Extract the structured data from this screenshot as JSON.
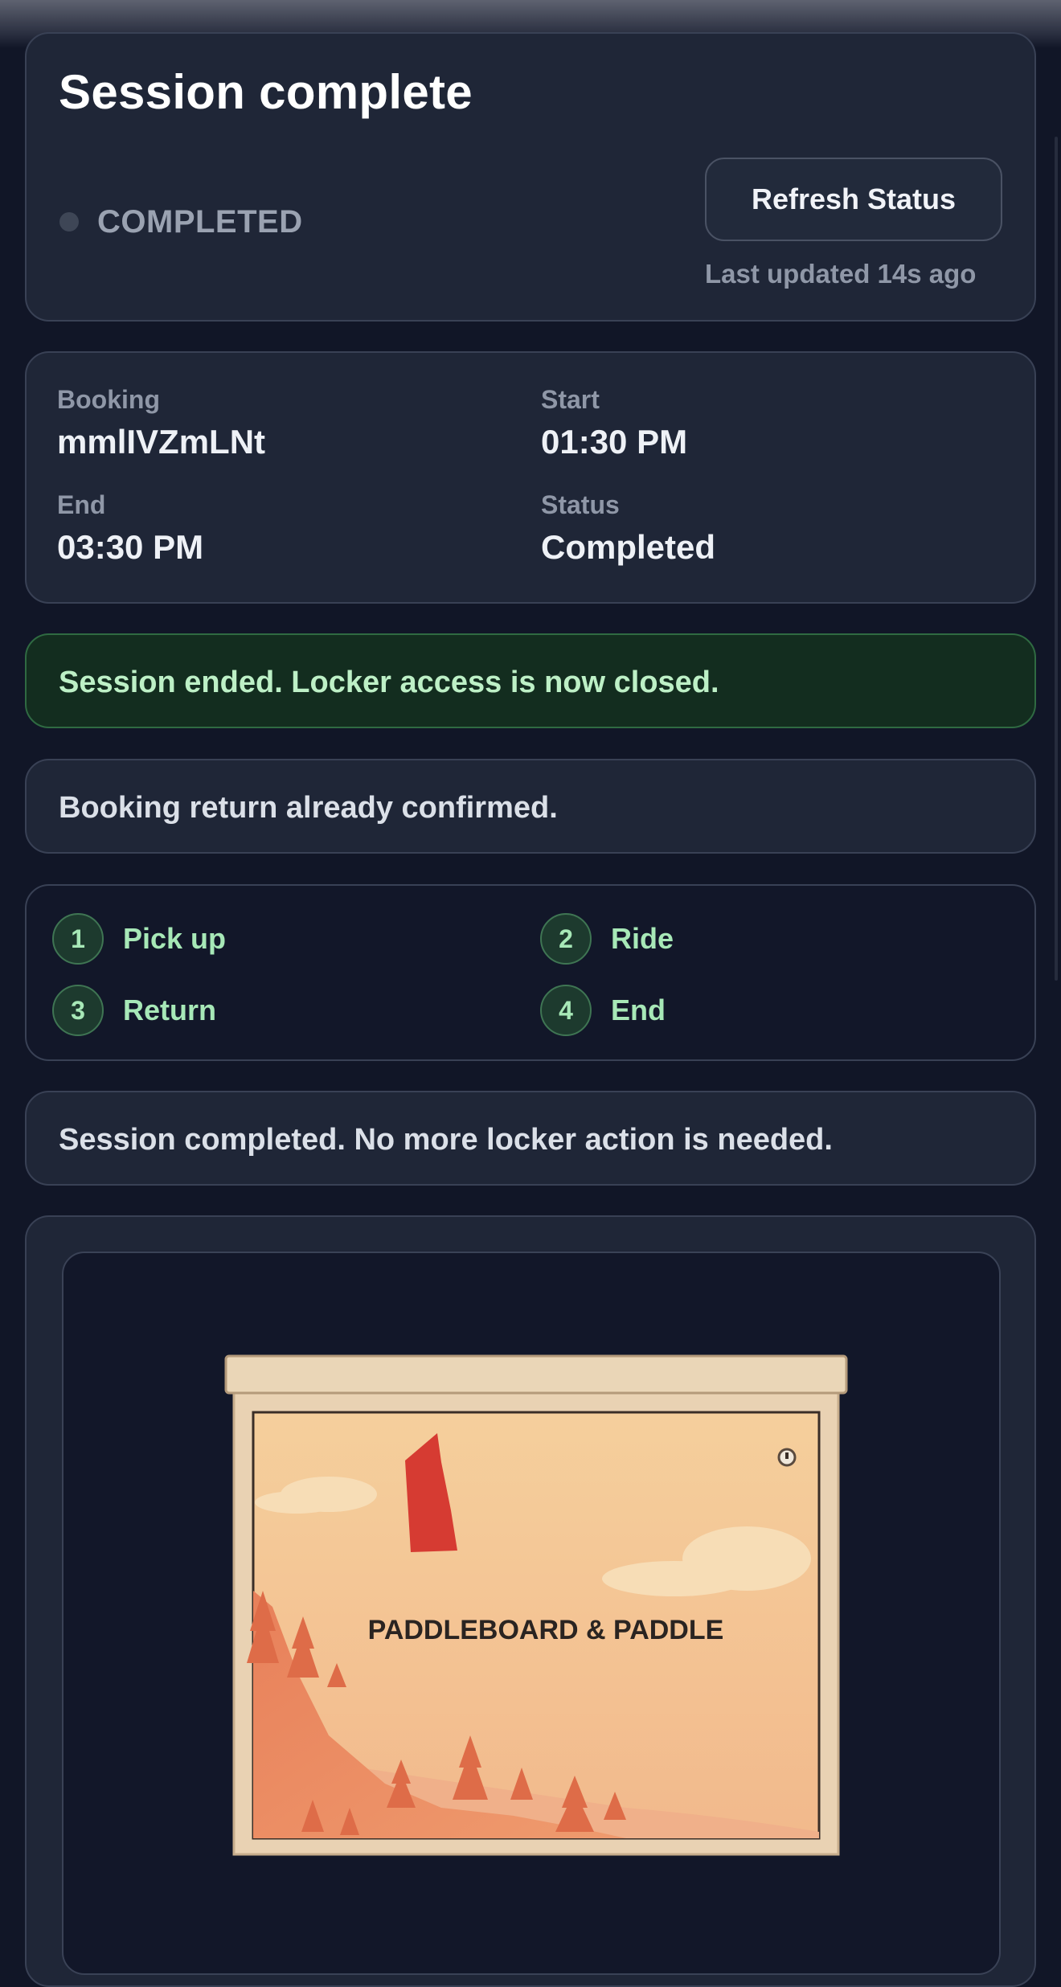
{
  "header": {
    "title": "Session complete",
    "status": "COMPLETED",
    "refresh_label": "Refresh Status",
    "last_updated": "Last updated 14s ago"
  },
  "details": {
    "booking_label": "Booking",
    "booking_value": "mmlIVZmLNt",
    "start_label": "Start",
    "start_value": "01:30 PM",
    "end_label": "End",
    "end_value": "03:30 PM",
    "status_label": "Status",
    "status_value": "Completed"
  },
  "messages": {
    "session_ended": "Session ended. Locker access is now closed.",
    "return_confirmed": "Booking return already confirmed.",
    "no_action": "Session completed. No more locker action is needed."
  },
  "steps": [
    {
      "num": "1",
      "label": "Pick up"
    },
    {
      "num": "2",
      "label": "Ride"
    },
    {
      "num": "3",
      "label": "Return"
    },
    {
      "num": "4",
      "label": "End"
    }
  ],
  "locker": {
    "label": "PADDLEBOARD & PADDLE"
  },
  "colors": {
    "background": "#111627",
    "card": "#1f2637",
    "success_bg": "#132d1f",
    "success_text": "#bdf0c6",
    "step_green": "#a7e8b7"
  }
}
